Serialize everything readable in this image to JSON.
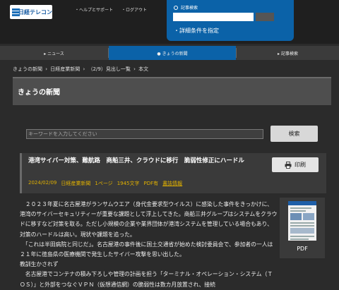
{
  "header": {
    "logo_text": "日経テレコン",
    "links": [
      "・ヘルプとサポート",
      "・ログアウト"
    ]
  },
  "search_panel": {
    "title": "記事検索",
    "input_placeholder": "",
    "advanced_link": "・詳細条件を指定"
  },
  "nav": {
    "tabs": [
      {
        "label": "▸ ニュース",
        "active": false
      },
      {
        "label": "● きょうの新聞",
        "active": true
      },
      {
        "label": "▸ 記事検索",
        "active": false
      }
    ]
  },
  "breadcrumb": {
    "items": [
      "きょうの新聞",
      "日経産業新聞",
      "（2/9）見出し一覧",
      "本文"
    ],
    "separator": "›"
  },
  "page": {
    "title": "きょうの新聞"
  },
  "keyword": {
    "placeholder": "キーワードを入力してください",
    "button_label": "検索"
  },
  "article": {
    "title": "港湾サイバー対策、難航路　商船三井、クラウドに移行　脆弱性修正にハードル",
    "date": "2024/02/09",
    "paper": "日経産業新聞",
    "page": "1ページ",
    "chars": "1945文字",
    "pdf": "PDF有",
    "info_link": "書誌情報",
    "print_label": "印刷",
    "paragraphs": [
      "　２０２３年夏に名古屋港がランサムウエア（身代金要求型ウイルス）に感染した事件をきっかけに、港湾のサイバーセキュリティーが重要な課題として浮上してきた。商船三井グループはシステムをクラウドに移すなど対策を取る。ただし小規模の企業や業界団体が港湾システムを管理している場合もあり、対策のハードルは高い。現状や課題を追った。",
      "　「これは半田病院と同じだ」。名古屋港の事件後に国土交通省が始めた検討委員会で、参加者の一人は２１年に徳島県の医療機関で発生したサイバー攻撃を思い出した。",
      "教訓生かされず",
      "　名古屋港でコンテナの積み下ろしや管理の計画を担う「ターミナル・オペレーション・システム（ＴＯＳ）」と外部をつなぐＶＰＮ（仮想通信網）の脆弱性は数カ月放置され、接続"
    ],
    "pdf_label": "PDF"
  },
  "colors": {
    "accent": "#0b62a8",
    "meta": "#e0b000",
    "background": "#2b2b2b"
  }
}
